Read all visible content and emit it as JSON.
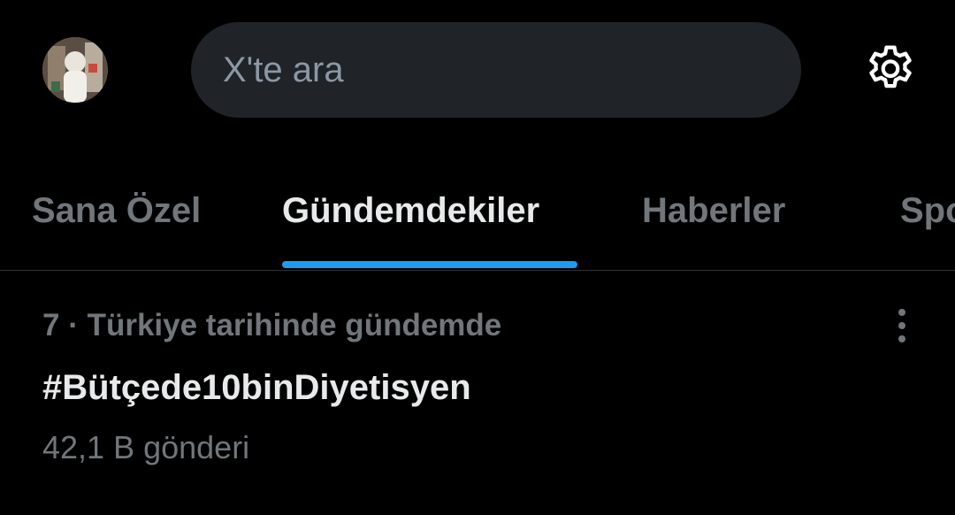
{
  "header": {
    "avatar_icon": "user-avatar",
    "search": {
      "placeholder": "X'te ara",
      "value": ""
    },
    "settings_icon": "gear-icon"
  },
  "tabs": [
    {
      "label": "Sana Özel",
      "active": false
    },
    {
      "label": "Gündemdekiler",
      "active": true
    },
    {
      "label": "Haberler",
      "active": false
    },
    {
      "label": "Spor",
      "active": false
    }
  ],
  "trend": {
    "context": "7 · Türkiye tarihinde gündemde",
    "title": "#Bütçede10binDiyetisyen",
    "count": "42,1 B gönderi",
    "more_icon": "more-vertical-icon"
  },
  "colors": {
    "background": "#000000",
    "accent": "#1d9bf0",
    "text_primary": "#e7e9ea",
    "text_secondary": "#71767b",
    "search_bg": "#202327",
    "divider": "#2f3336"
  }
}
